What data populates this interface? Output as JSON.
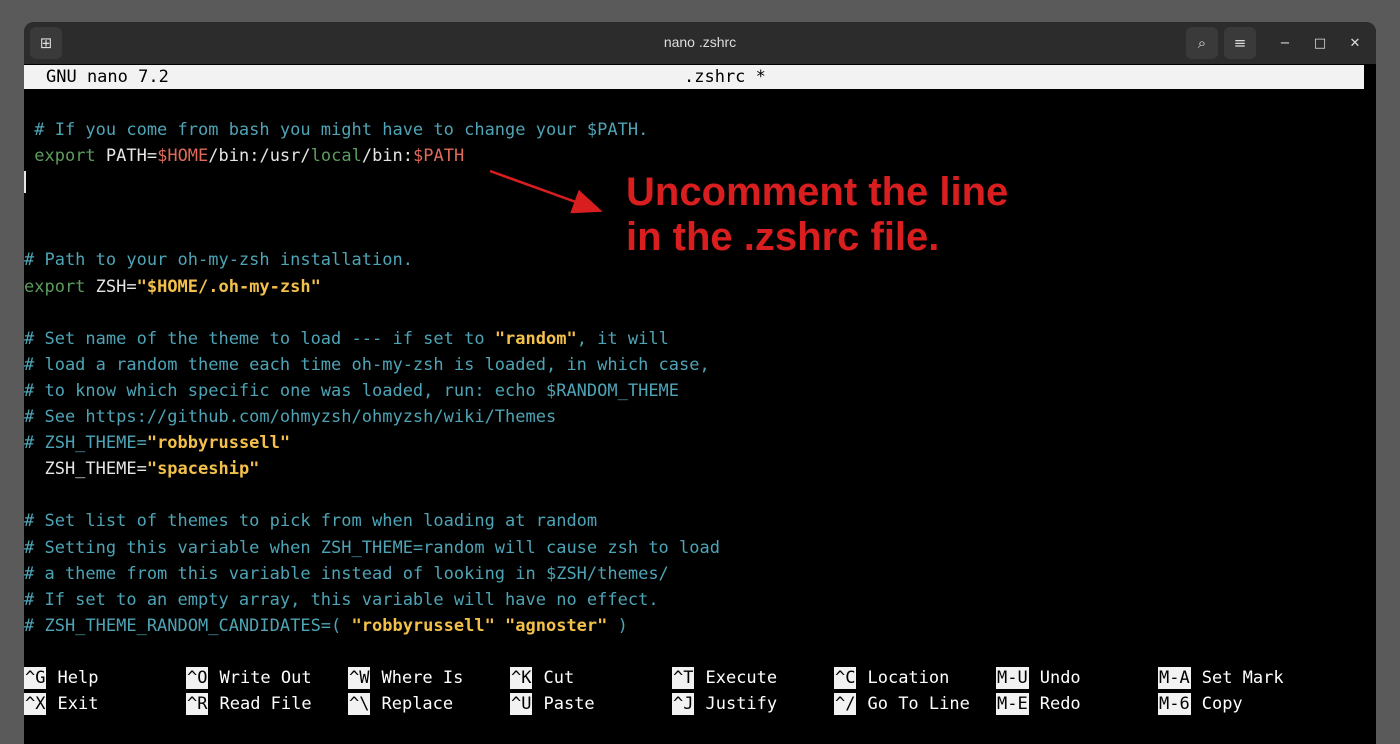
{
  "window": {
    "title": "nano .zshrc",
    "icons": {
      "terminal": "terminal-icon",
      "search": "search-icon",
      "menu": "menu-icon",
      "minimize": "minimize-icon",
      "maximize": "maximize-icon",
      "close": "close-icon"
    },
    "glyphs": {
      "terminal": "⊞",
      "search": "⌕",
      "menu": "≡",
      "minimize": "−",
      "maximize": "□",
      "close": "✕"
    }
  },
  "nano": {
    "version": "GNU nano 7.2",
    "filename": ".zshrc *"
  },
  "editor": {
    "lines": [
      [
        {
          "t": " # If you come from bash you might have to change your $PATH.",
          "c": "c-comment"
        }
      ],
      [
        {
          "t": " ",
          "c": ""
        },
        {
          "t": "export",
          "c": "c-keyword"
        },
        {
          "t": " PATH=",
          "c": ""
        },
        {
          "t": "$HOME",
          "c": "c-var"
        },
        {
          "t": "/bin:/usr/",
          "c": ""
        },
        {
          "t": "local",
          "c": "c-loc"
        },
        {
          "t": "/bin:",
          "c": ""
        },
        {
          "t": "$PATH",
          "c": "c-var"
        }
      ],
      [
        {
          "t": "",
          "c": "cursor"
        }
      ],
      [],
      [],
      [
        {
          "t": "# Path to your oh-my-zsh installation.",
          "c": "c-comment"
        }
      ],
      [
        {
          "t": "export",
          "c": "c-keyword"
        },
        {
          "t": " ZSH=",
          "c": ""
        },
        {
          "t": "\"$HOME/.oh-my-zsh\"",
          "c": "c-str"
        }
      ],
      [],
      [
        {
          "t": "# Set name of the theme to load --- if set to ",
          "c": "c-comment"
        },
        {
          "t": "\"random\"",
          "c": "c-str"
        },
        {
          "t": ", it will",
          "c": "c-comment"
        }
      ],
      [
        {
          "t": "# load a random theme each time oh-my-zsh is loaded, in which case,",
          "c": "c-comment"
        }
      ],
      [
        {
          "t": "# to know which specific one was loaded, run: echo $RANDOM_THEME",
          "c": "c-comment"
        }
      ],
      [
        {
          "t": "# See https://github.com/ohmyzsh/ohmyzsh/wiki/Themes",
          "c": "c-comment"
        }
      ],
      [
        {
          "t": "# ZSH_THEME=",
          "c": "c-comment"
        },
        {
          "t": "\"robbyrussell\"",
          "c": "c-str"
        }
      ],
      [
        {
          "t": "  ZSH_THEME=",
          "c": ""
        },
        {
          "t": "\"spaceship\"",
          "c": "c-str"
        }
      ],
      [],
      [
        {
          "t": "# Set list of themes to pick from when loading at random",
          "c": "c-comment"
        }
      ],
      [
        {
          "t": "# Setting this variable when ZSH_THEME=random will cause zsh to load",
          "c": "c-comment"
        }
      ],
      [
        {
          "t": "# a theme from this variable instead of looking in $ZSH/themes/",
          "c": "c-comment"
        }
      ],
      [
        {
          "t": "# If set to an empty array, this variable will have no effect.",
          "c": "c-comment"
        }
      ],
      [
        {
          "t": "# ZSH_THEME_RANDOM_CANDIDATES=( ",
          "c": "c-comment"
        },
        {
          "t": "\"robbyrussell\" \"agnoster\"",
          "c": "c-str"
        },
        {
          "t": " )",
          "c": "c-comment"
        }
      ]
    ]
  },
  "annotation": {
    "line1": "Uncomment the line",
    "line2": "in the .zshrc file.",
    "color": "#d81e1e"
  },
  "shortcuts": {
    "row1": [
      {
        "key": "^G",
        "label": "Help"
      },
      {
        "key": "^O",
        "label": "Write Out"
      },
      {
        "key": "^W",
        "label": "Where Is"
      },
      {
        "key": "^K",
        "label": "Cut"
      },
      {
        "key": "^T",
        "label": "Execute"
      },
      {
        "key": "^C",
        "label": "Location"
      },
      {
        "key": "M-U",
        "label": "Undo"
      },
      {
        "key": "M-A",
        "label": "Set Mark"
      }
    ],
    "row2": [
      {
        "key": "^X",
        "label": "Exit"
      },
      {
        "key": "^R",
        "label": "Read File"
      },
      {
        "key": "^\\",
        "label": "Replace"
      },
      {
        "key": "^U",
        "label": "Paste"
      },
      {
        "key": "^J",
        "label": "Justify"
      },
      {
        "key": "^/",
        "label": "Go To Line"
      },
      {
        "key": "M-E",
        "label": "Redo"
      },
      {
        "key": "M-6",
        "label": "Copy"
      }
    ]
  }
}
